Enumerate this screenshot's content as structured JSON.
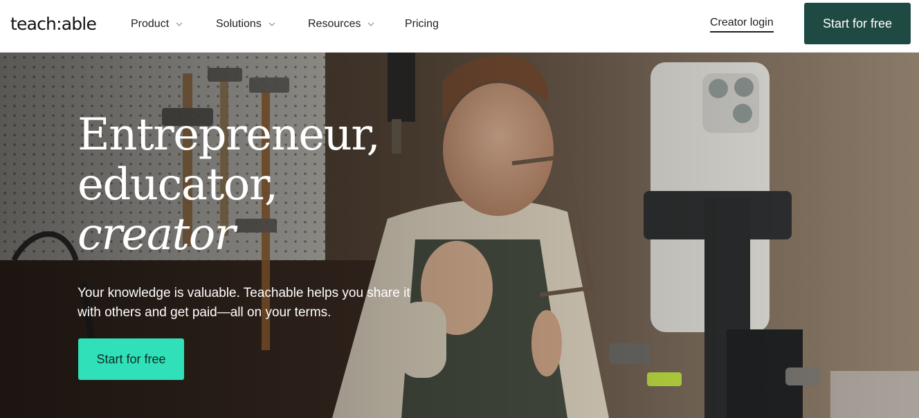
{
  "brand": {
    "logo": "teach:able"
  },
  "nav": {
    "items": [
      {
        "label": "Product",
        "has_dropdown": true,
        "icon": "chevron-down-icon"
      },
      {
        "label": "Solutions",
        "has_dropdown": true,
        "icon": "chevron-down-icon"
      },
      {
        "label": "Resources",
        "has_dropdown": true,
        "icon": "chevron-down-icon"
      },
      {
        "label": "Pricing",
        "has_dropdown": false
      }
    ],
    "login": "Creator login",
    "cta": "Start for free"
  },
  "hero": {
    "headline_line1": "Entrepreneur,",
    "headline_line2": "educator,",
    "headline_line3": "creator",
    "subtitle": "Your knowledge is valuable. Teachable helps you share it with others and get paid—all on your terms.",
    "cta": "Start for free"
  },
  "colors": {
    "header_cta_bg": "#1f4a44",
    "hero_cta_bg": "#2fe0b8",
    "text_dark": "#1d1d1d"
  }
}
